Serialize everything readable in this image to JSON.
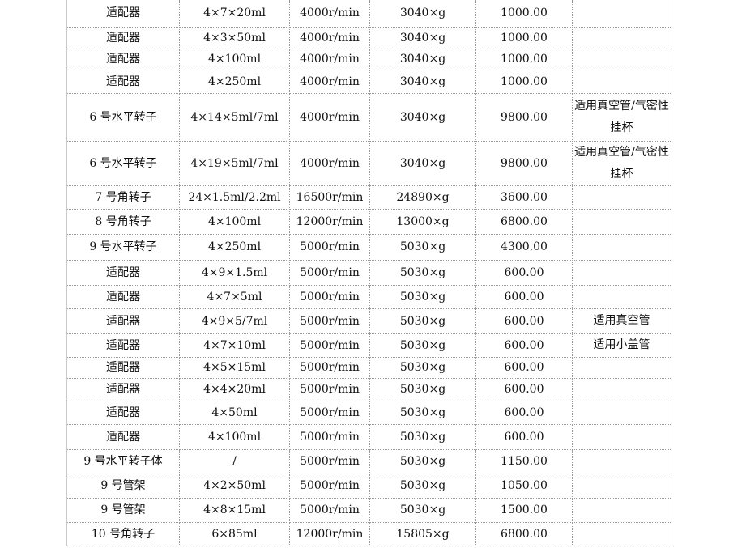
{
  "rows": [
    {
      "name": "适配器",
      "capacity": "4×7×20ml",
      "speed": "4000r/min",
      "rcf": "3040×g",
      "price": "1000.00",
      "note": ""
    },
    {
      "name": "适配器",
      "capacity": "4×3×50ml",
      "speed": "4000r/min",
      "rcf": "3040×g",
      "price": "1000.00",
      "note": ""
    },
    {
      "name": "适配器",
      "capacity": "4×100ml",
      "speed": "4000r/min",
      "rcf": "3040×g",
      "price": "1000.00",
      "note": ""
    },
    {
      "name": "适配器",
      "capacity": "4×250ml",
      "speed": "4000r/min",
      "rcf": "3040×g",
      "price": "1000.00",
      "note": ""
    },
    {
      "name": "6 号水平转子",
      "capacity": "4×14×5ml/7ml",
      "speed": "4000r/min",
      "rcf": "3040×g",
      "price": "9800.00",
      "note": "适用真空管/气密性挂杯"
    },
    {
      "name": "6 号水平转子",
      "capacity": "4×19×5ml/7ml",
      "speed": "4000r/min",
      "rcf": "3040×g",
      "price": "9800.00",
      "note": "适用真空管/气密性挂杯"
    },
    {
      "name": "7 号角转子",
      "capacity": "24×1.5ml/2.2ml",
      "speed": "16500r/min",
      "rcf": "24890×g",
      "price": "3600.00",
      "note": ""
    },
    {
      "name": "8 号角转子",
      "capacity": "4×100ml",
      "speed": "12000r/min",
      "rcf": "13000×g",
      "price": "6800.00",
      "note": ""
    },
    {
      "name": "9 号水平转子",
      "capacity": "4×250ml",
      "speed": "5000r/min",
      "rcf": "5030×g",
      "price": "4300.00",
      "note": ""
    },
    {
      "name": "适配器",
      "capacity": "4×9×1.5ml",
      "speed": "5000r/min",
      "rcf": "5030×g",
      "price": "600.00",
      "note": ""
    },
    {
      "name": "适配器",
      "capacity": "4×7×5ml",
      "speed": "5000r/min",
      "rcf": "5030×g",
      "price": "600.00",
      "note": ""
    },
    {
      "name": "适配器",
      "capacity": "4×9×5/7ml",
      "speed": "5000r/min",
      "rcf": "5030×g",
      "price": "600.00",
      "note": "适用真空管"
    },
    {
      "name": "适配器",
      "capacity": "4×7×10ml",
      "speed": "5000r/min",
      "rcf": "5030×g",
      "price": "600.00",
      "note": "适用小盖管"
    },
    {
      "name": "适配器",
      "capacity": "4×5×15ml",
      "speed": "5000r/min",
      "rcf": "5030×g",
      "price": "600.00",
      "note": ""
    },
    {
      "name": "适配器",
      "capacity": "4×4×20ml",
      "speed": "5000r/min",
      "rcf": "5030×g",
      "price": "600.00",
      "note": ""
    },
    {
      "name": "适配器",
      "capacity": "4×50ml",
      "speed": "5000r/min",
      "rcf": "5030×g",
      "price": "600.00",
      "note": ""
    },
    {
      "name": "适配器",
      "capacity": "4×100ml",
      "speed": "5000r/min",
      "rcf": "5030×g",
      "price": "600.00",
      "note": ""
    },
    {
      "name": "9 号水平转子体",
      "capacity": "/",
      "speed": "5000r/min",
      "rcf": "5030×g",
      "price": "1150.00",
      "note": ""
    },
    {
      "name": "9 号管架",
      "capacity": "4×2×50ml",
      "speed": "5000r/min",
      "rcf": "5030×g",
      "price": "1050.00",
      "note": ""
    },
    {
      "name": "9 号管架",
      "capacity": "4×8×15ml",
      "speed": "5000r/min",
      "rcf": "5030×g",
      "price": "1500.00",
      "note": ""
    },
    {
      "name": "10 号角转子",
      "capacity": "6×85ml",
      "speed": "12000r/min",
      "rcf": "15805×g",
      "price": "6800.00",
      "note": ""
    }
  ]
}
